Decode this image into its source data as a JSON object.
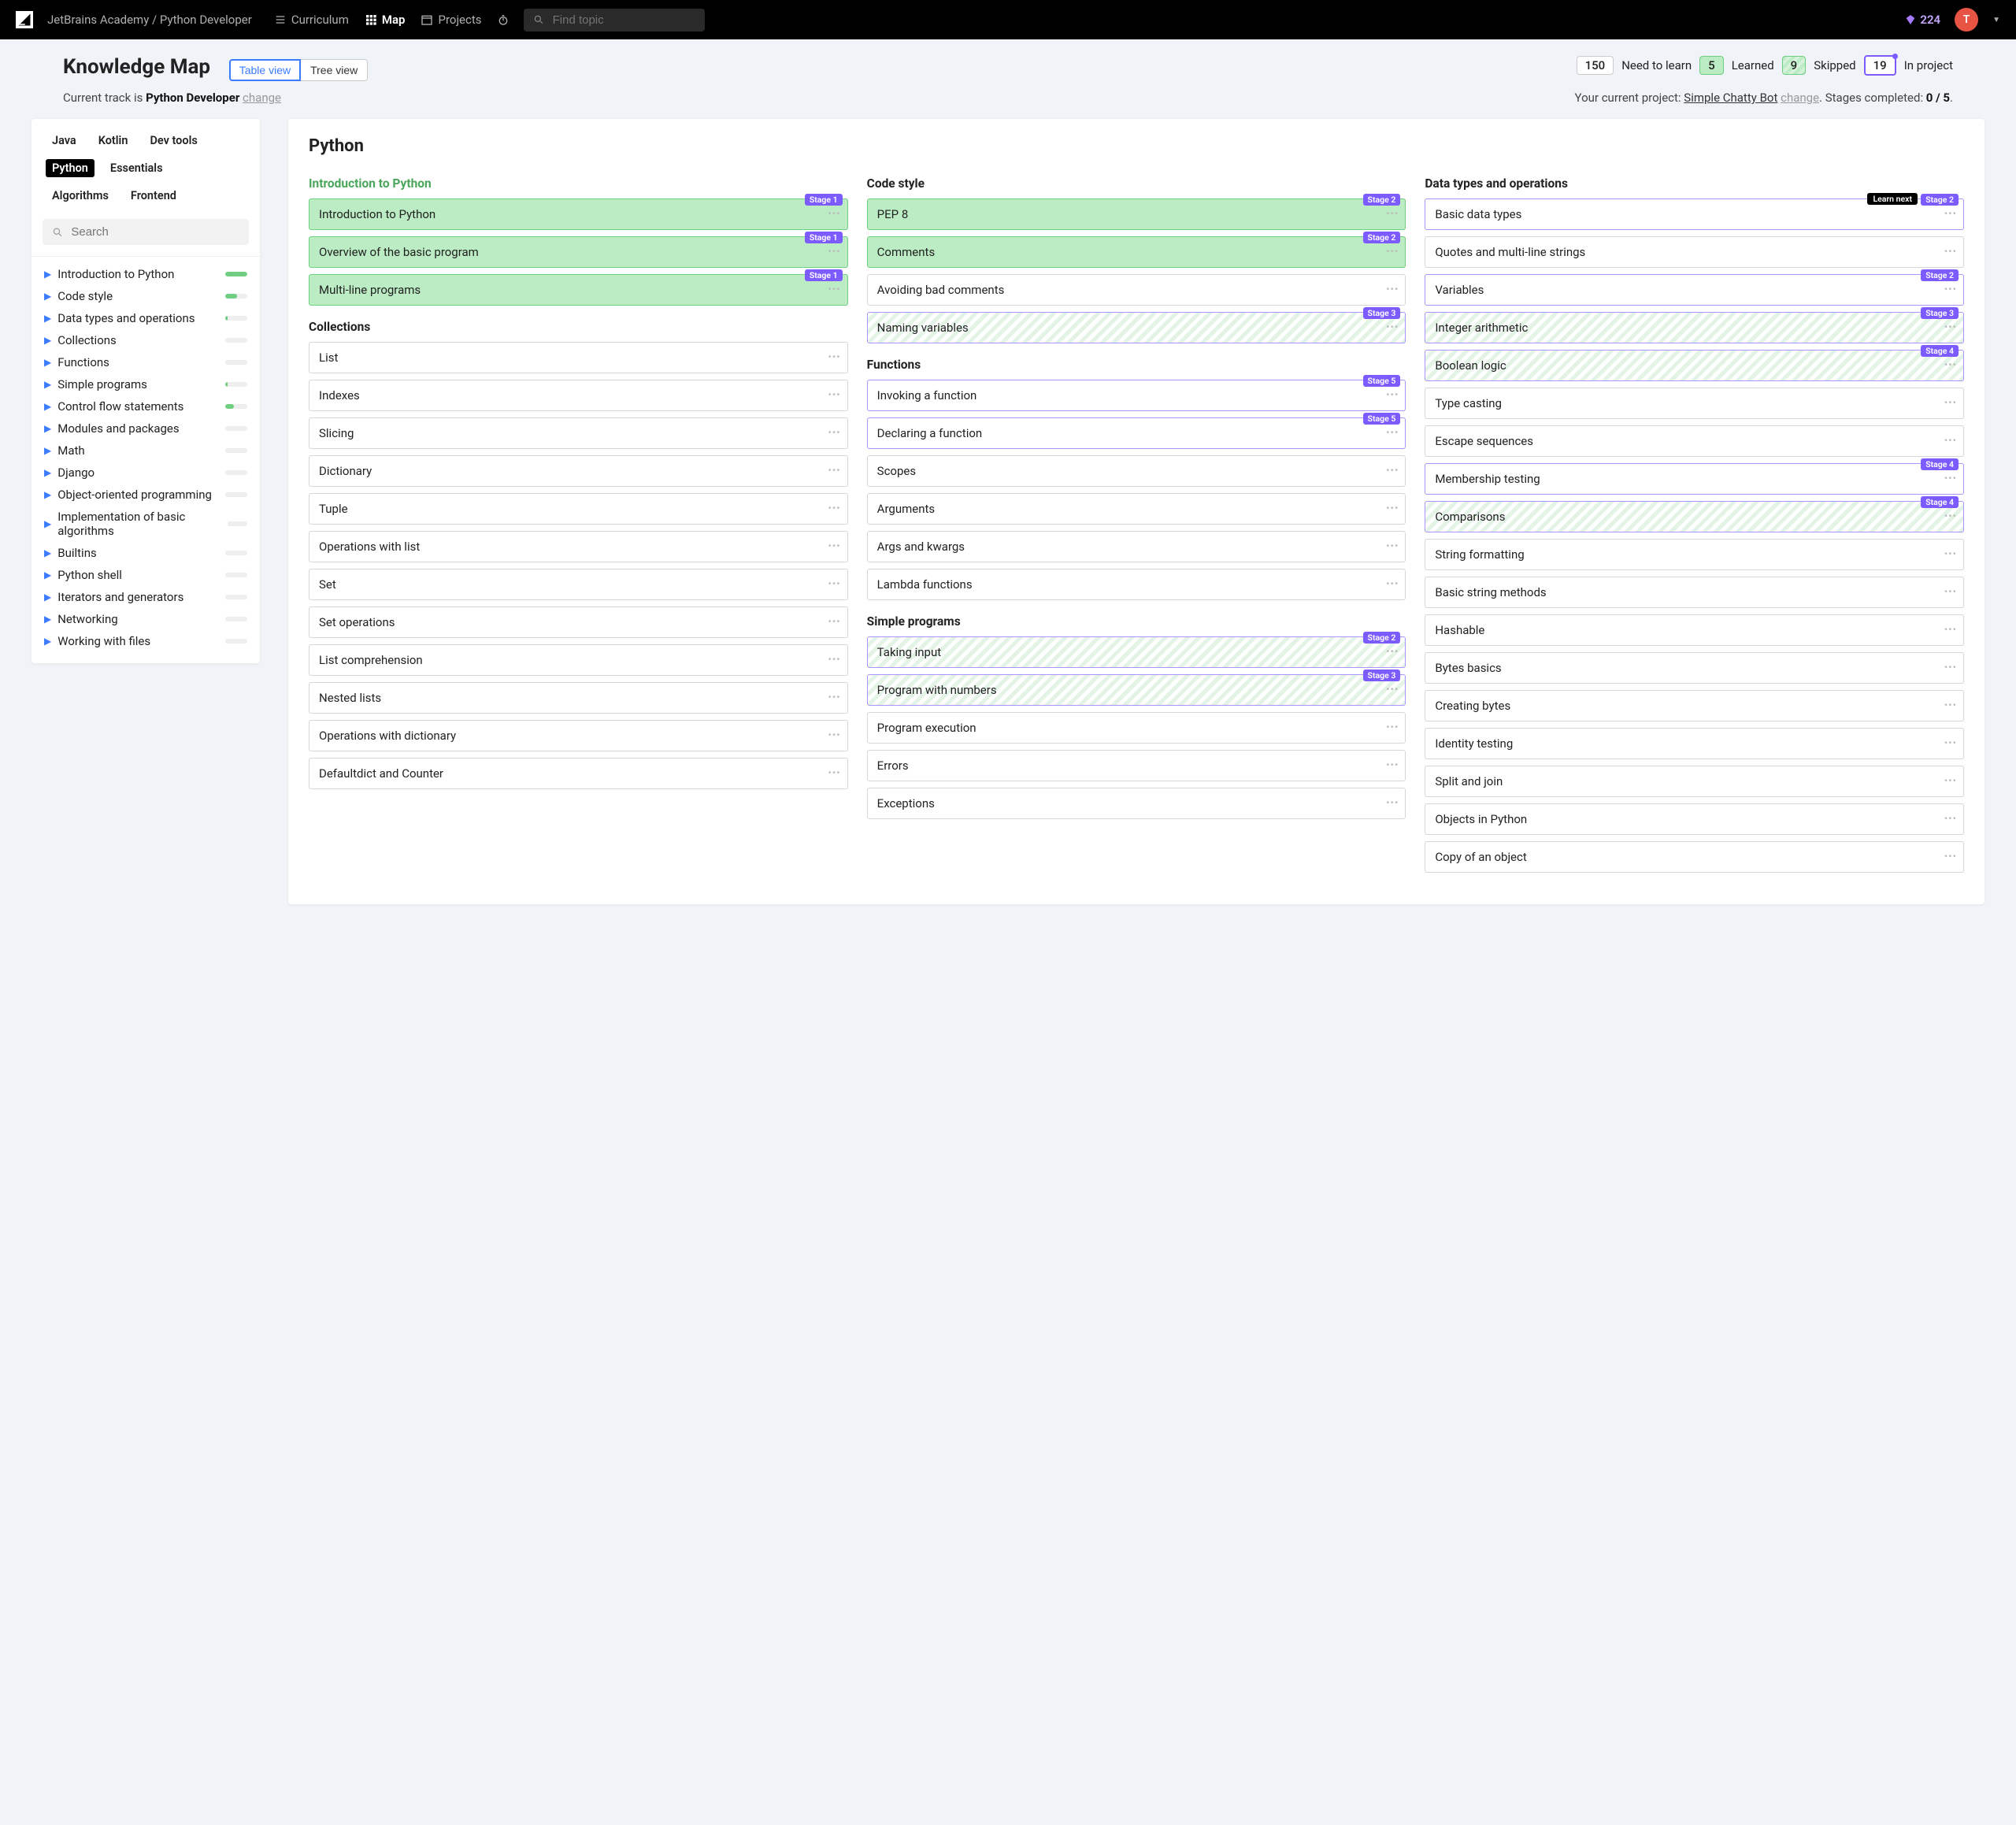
{
  "topbar": {
    "breadcrumb": "JetBrains Academy / Python Developer",
    "nav": {
      "curriculum": "Curriculum",
      "map": "Map",
      "projects": "Projects"
    },
    "search_placeholder": "Find topic",
    "gems": "224",
    "avatar_letter": "T"
  },
  "header": {
    "title": "Knowledge Map",
    "view_table": "Table view",
    "view_tree": "Tree view",
    "stats": {
      "need": {
        "count": "150",
        "label": "Need to learn"
      },
      "learned": {
        "count": "5",
        "label": "Learned"
      },
      "skipped": {
        "count": "9",
        "label": "Skipped"
      },
      "inproject": {
        "count": "19",
        "label": "In project"
      }
    },
    "track_prefix": "Current track is ",
    "track_name": "Python Developer",
    "change": "change",
    "project_prefix": "Your current project: ",
    "project_name": "Simple Chatty Bot",
    "stages_label": ". Stages completed: ",
    "stages_value": "0 / 5",
    "period": "."
  },
  "sidebar": {
    "tabs": [
      "Java",
      "Kotlin",
      "Dev tools",
      "Python",
      "Essentials",
      "Algorithms",
      "Frontend"
    ],
    "active_tab": "Python",
    "search_placeholder": "Search",
    "tree": [
      {
        "label": "Introduction to Python",
        "progress": 100
      },
      {
        "label": "Code style",
        "progress": 55
      },
      {
        "label": "Data types and operations",
        "progress": 10
      },
      {
        "label": "Collections",
        "progress": 0
      },
      {
        "label": "Functions",
        "progress": 0
      },
      {
        "label": "Simple programs",
        "progress": 12
      },
      {
        "label": "Control flow statements",
        "progress": 40
      },
      {
        "label": "Modules and packages",
        "progress": 0
      },
      {
        "label": "Math",
        "progress": 0
      },
      {
        "label": "Django",
        "progress": 0
      },
      {
        "label": "Object-oriented programming",
        "progress": 0
      },
      {
        "label": "Implementation of basic algorithms",
        "progress": 0
      },
      {
        "label": "Builtins",
        "progress": 0
      },
      {
        "label": "Python shell",
        "progress": 0
      },
      {
        "label": "Iterators and generators",
        "progress": 0
      },
      {
        "label": "Networking",
        "progress": 0
      },
      {
        "label": "Working with files",
        "progress": 0
      }
    ]
  },
  "content": {
    "title": "Python",
    "col1": {
      "section1": {
        "title": "Introduction to Python",
        "cards": [
          {
            "label": "Introduction to Python",
            "state": "learned",
            "stage": "Stage 1"
          },
          {
            "label": "Overview of the basic program",
            "state": "learned",
            "stage": "Stage 1"
          },
          {
            "label": "Multi-line programs",
            "state": "learned",
            "stage": "Stage 1"
          }
        ]
      },
      "section2": {
        "title": "Collections",
        "cards": [
          {
            "label": "List"
          },
          {
            "label": "Indexes"
          },
          {
            "label": "Slicing"
          },
          {
            "label": "Dictionary"
          },
          {
            "label": "Tuple"
          },
          {
            "label": "Operations with list"
          },
          {
            "label": "Set"
          },
          {
            "label": "Set operations"
          },
          {
            "label": "List comprehension"
          },
          {
            "label": "Nested lists"
          },
          {
            "label": "Operations with dictionary"
          },
          {
            "label": "Defaultdict and Counter"
          }
        ]
      }
    },
    "col2": {
      "section1": {
        "title": "Code style",
        "cards": [
          {
            "label": "PEP 8",
            "state": "learned",
            "stage": "Stage 2"
          },
          {
            "label": "Comments",
            "state": "learned",
            "stage": "Stage 2",
            "inproject": true
          },
          {
            "label": "Avoiding bad comments"
          },
          {
            "label": "Naming variables",
            "state": "skipped",
            "stage": "Stage 3",
            "inproject": true
          }
        ]
      },
      "section2": {
        "title": "Functions",
        "cards": [
          {
            "label": "Invoking a function",
            "stage": "Stage 5",
            "inproject": true
          },
          {
            "label": "Declaring a function",
            "stage": "Stage 5",
            "inproject": true
          },
          {
            "label": "Scopes"
          },
          {
            "label": "Arguments"
          },
          {
            "label": "Args and kwargs"
          },
          {
            "label": "Lambda functions"
          }
        ]
      },
      "section3": {
        "title": "Simple programs",
        "cards": [
          {
            "label": "Taking input",
            "state": "skipped",
            "stage": "Stage 2",
            "inproject": true
          },
          {
            "label": "Program with numbers",
            "state": "skipped",
            "stage": "Stage 3",
            "inproject": true
          },
          {
            "label": "Program execution"
          },
          {
            "label": "Errors"
          },
          {
            "label": "Exceptions"
          }
        ]
      }
    },
    "col3": {
      "section1": {
        "title": "Data types and operations",
        "cards": [
          {
            "label": "Basic data types",
            "stage": "Stage 2",
            "inproject": true,
            "learn_next": "Learn next"
          },
          {
            "label": "Quotes and multi-line strings"
          },
          {
            "label": "Variables",
            "stage": "Stage 2",
            "inproject": true
          },
          {
            "label": "Integer arithmetic",
            "state": "skipped",
            "stage": "Stage 3",
            "inproject": true
          },
          {
            "label": "Boolean logic",
            "state": "skipped",
            "stage": "Stage 4",
            "inproject": true
          },
          {
            "label": "Type casting"
          },
          {
            "label": "Escape sequences"
          },
          {
            "label": "Membership testing",
            "stage": "Stage 4",
            "inproject": true
          },
          {
            "label": "Comparisons",
            "state": "skipped",
            "stage": "Stage 4",
            "inproject": true
          },
          {
            "label": "String formatting"
          },
          {
            "label": "Basic string methods"
          },
          {
            "label": "Hashable"
          },
          {
            "label": "Bytes basics"
          },
          {
            "label": "Creating bytes"
          },
          {
            "label": "Identity testing"
          },
          {
            "label": "Split and join"
          },
          {
            "label": "Objects in Python"
          },
          {
            "label": "Copy of an object"
          }
        ]
      }
    }
  }
}
